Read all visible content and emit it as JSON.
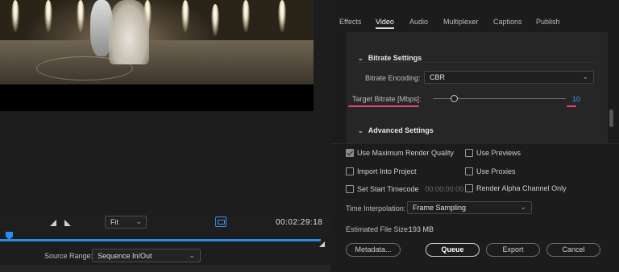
{
  "monitor": {
    "zoom": "Fit",
    "timecode": "00:02:29:18",
    "source_range_label": "Source Range:",
    "source_range_value": "Sequence In/Out"
  },
  "tabs": [
    "Effects",
    "Video",
    "Audio",
    "Multiplexer",
    "Captions",
    "Publish"
  ],
  "active_tab": "Video",
  "bitrate": {
    "section": "Bitrate Settings",
    "encoding_label": "Bitrate Encoding:",
    "encoding_value": "CBR",
    "target_label": "Target Bitrate [Mbps]:",
    "target_value": "10",
    "target_fraction": 0.16
  },
  "advanced": {
    "section": "Advanced Settings"
  },
  "options": {
    "max_quality": "Use Maximum Render Quality",
    "previews": "Use Previews",
    "import_project": "Import Into Project",
    "proxies": "Use Proxies",
    "start_timecode": "Set Start Timecode",
    "start_timecode_value": "00:00:00:00",
    "alpha_only": "Render Alpha Channel Only"
  },
  "interpolation": {
    "label": "Time Interpolation:",
    "value": "Frame Sampling"
  },
  "file_size": {
    "label": "Estimated File Size:",
    "value": "193 MB"
  },
  "buttons": {
    "metadata": "Metadata...",
    "queue": "Queue",
    "export": "Export",
    "cancel": "Cancel"
  },
  "colors": {
    "accent": "#2d8ceb",
    "highlight": "#e0457b",
    "value": "#3f9bf0"
  }
}
